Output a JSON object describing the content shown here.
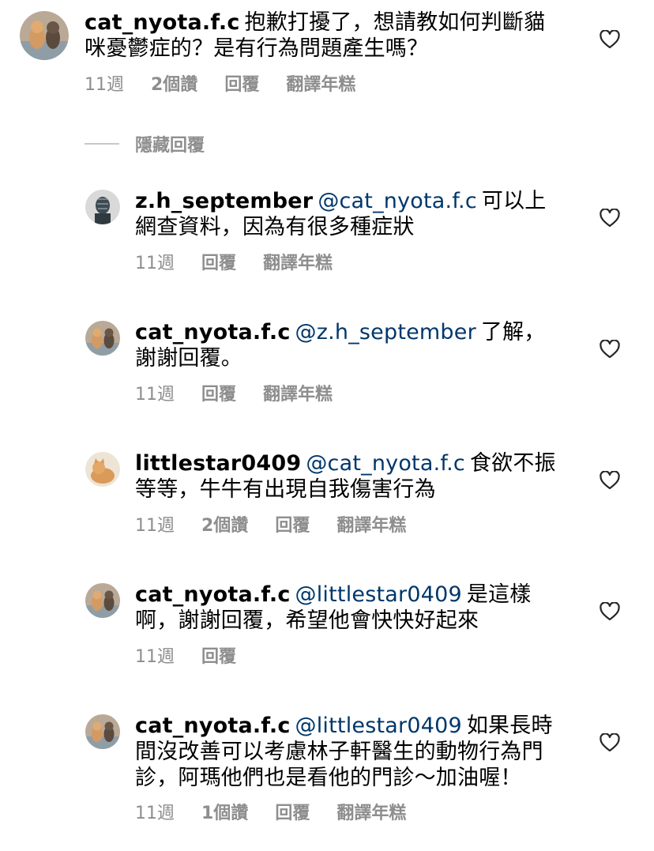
{
  "parent": {
    "username": "cat_nyota.f.c",
    "text": "抱歉打擾了，想請教如何判斷貓咪憂鬱症的？是有行為問題產生嗎？",
    "time": "11週",
    "likes": "2個讚",
    "reply": "回覆",
    "translate": "翻譯年糕"
  },
  "hide_replies_label": "隱藏回覆",
  "replies": [
    {
      "username": "z.h_september",
      "mention": "@cat_nyota.f.c",
      "text": "可以上網查資料，因為有很多種症狀",
      "time": "11週",
      "reply": "回覆",
      "translate": "翻譯年糕"
    },
    {
      "username": "cat_nyota.f.c",
      "mention": "@z.h_september",
      "text": "了解，謝謝回覆。",
      "time": "11週",
      "reply": "回覆",
      "translate": "翻譯年糕"
    },
    {
      "username": "littlestar0409",
      "mention": "@cat_nyota.f.c",
      "text": "食欲不振等等，牛牛有出現自我傷害行為",
      "time": "11週",
      "likes": "2個讚",
      "reply": "回覆",
      "translate": "翻譯年糕"
    },
    {
      "username": "cat_nyota.f.c",
      "mention": "@littlestar0409",
      "text": "是這樣啊，謝謝回覆，希望他會快快好起來",
      "time": "11週",
      "reply": "回覆"
    },
    {
      "username": "cat_nyota.f.c",
      "mention": "@littlestar0409",
      "text": "如果長時間沒改善可以考慮林子軒醫生的動物行為門診，阿瑪他們也是看他的門診～加油喔！",
      "time": "11週",
      "likes": "1個讚",
      "reply": "回覆",
      "translate": "翻譯年糕"
    }
  ],
  "icons": {
    "like": "heart-outline-icon",
    "avatar": "avatar-photo"
  },
  "colors": {
    "mention": "#00376b",
    "meta": "#8e8e8e"
  }
}
